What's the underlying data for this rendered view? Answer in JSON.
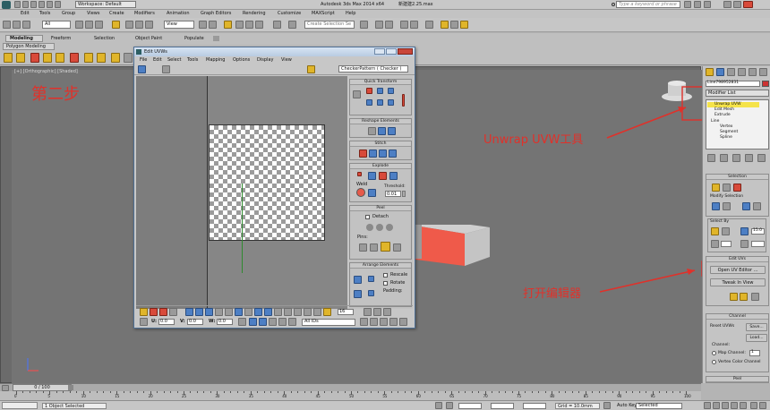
{
  "title_bar": {
    "workspace": "Workspace: Default",
    "app_title": "Autodesk 3ds Max  2014 x64",
    "file_name": "新建建2.25.max",
    "search_placeholder": "Type a keyword or phrase"
  },
  "menu": [
    "Edit",
    "Tools",
    "Group",
    "Views",
    "Create",
    "Modifiers",
    "Animation",
    "Graph Editors",
    "Rendering",
    "Customize",
    "MAXScript",
    "Help"
  ],
  "toolbar": {
    "selection_filter": "All",
    "view_dropdown": "View",
    "selection_set": "Create Selection Se"
  },
  "ribbon_tabs": [
    "Modeling",
    "Freeform",
    "Selection",
    "Object Paint",
    "Populate"
  ],
  "ribbon_subtab": "Polygon Modeling",
  "viewport": {
    "label": "[+] [Orthographic] [Shaded]"
  },
  "annotations": {
    "step": "第二步",
    "unwrap_tool": "Unwrap UVW工具",
    "open_editor": "打开编辑器"
  },
  "uvw_window": {
    "title": "Edit UVWs",
    "menu": [
      "File",
      "Edit",
      "Select",
      "Tools",
      "Mapping",
      "Options",
      "Display",
      "View"
    ],
    "checker_dropdown": "CheckerPattern  ( Checker )",
    "panels": {
      "quick_transform": "Quick Transform",
      "reshape": "Reshape Elements",
      "stitch": "Stitch",
      "explode": "Explode",
      "weld": "Weld",
      "threshold_label": "Threshold:",
      "threshold_value": "0.01",
      "peel": "Peel",
      "detach": "Detach",
      "pins": "Pins:",
      "arrange": "Arrange Elements",
      "rescale": "Rescale",
      "rotate": "Rotate",
      "padding": "Padding:"
    },
    "bottom": {
      "u_label": "U:",
      "u_value": "0.0",
      "v_label": "V:",
      "v_value": "0.0",
      "w_label": "W:",
      "w_value": "0.0",
      "id_dropdown": "All IDs",
      "zoom_value": "16"
    }
  },
  "command_panel": {
    "object_name": "Line798952831",
    "modifier_list": "Modifier List",
    "stack": [
      "Unwrap UVW",
      "Edit Mesh",
      "Extrude",
      "Line",
      "Vertex",
      "Segment",
      "Spline"
    ],
    "selection_title": "Selection",
    "modify_selection": "Modify Selection",
    "select_by": "Select By",
    "select_by_value": "15.0",
    "edit_uvs_title": "Edit UVs",
    "open_uv_editor": "Open UV Editor ...",
    "tweak_in_view": "Tweak In View",
    "channel_title": "Channel",
    "reset_uvws": "Reset UVWs",
    "save": "Save...",
    "load": "Load...",
    "channel_label": "Channel:",
    "map_channel": "Map Channel:",
    "map_channel_value": "1",
    "vertex_color_channel": "Vertex Color Channel",
    "peel_title": "Peel"
  },
  "timeline": {
    "frame": "0 / 100",
    "ticks": [
      "0",
      "5",
      "10",
      "15",
      "20",
      "25",
      "30",
      "35",
      "40",
      "45",
      "50",
      "55",
      "60",
      "65",
      "70",
      "75",
      "80",
      "85",
      "90",
      "95",
      "100"
    ]
  },
  "status": {
    "message": "1 Object Selected",
    "grid": "Grid = 10.0mm",
    "auto_key": "Auto Key",
    "key_mode": "Selected"
  }
}
